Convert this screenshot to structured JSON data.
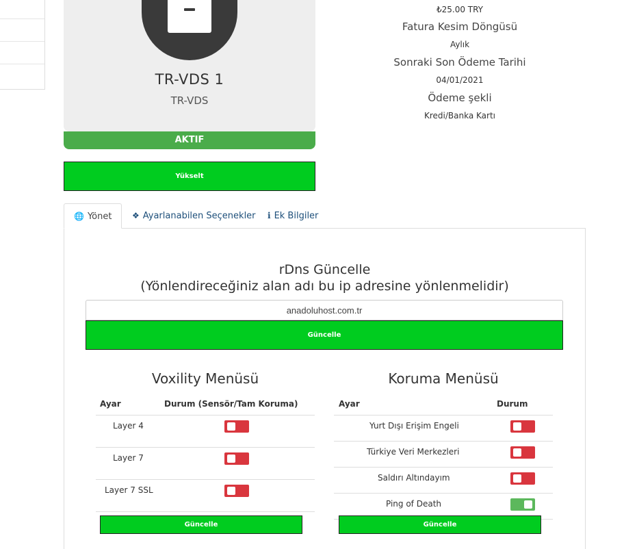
{
  "product": {
    "name": "TR-VDS 1",
    "group": "TR-VDS",
    "status": "AKTIF",
    "upgrade_label": "Yükselt"
  },
  "billing": {
    "amount": "₺25.00 TRY",
    "cycle_label": "Fatura Kesim Döngüsü",
    "cycle_value": "Aylık",
    "due_label": "Sonraki Son Ödeme Tarihi",
    "due_value": "04/01/2021",
    "payment_label": "Ödeme şekli",
    "payment_value": "Kredi/Banka Kartı"
  },
  "tabs": [
    {
      "label": "Yönet",
      "icon": "globe-icon"
    },
    {
      "label": "Ayarlanabilen Seçenekler",
      "icon": "cubes-icon"
    },
    {
      "label": "Ek Bilgiler",
      "icon": "info-icon"
    }
  ],
  "rdns": {
    "title_line1": "rDns Güncelle",
    "title_line2": "(Yönlendireceğiniz alan adı bu ip adresine yönlenmelidir)",
    "input_value": "anadoluhost.com.tr",
    "button_label": "Güncelle"
  },
  "voxility": {
    "title": "Voxility Menüsü",
    "col_setting": "Ayar",
    "col_status": "Durum (Sensör/Tam Koruma)",
    "rows": [
      {
        "label": "Layer 4",
        "on": false
      },
      {
        "label": "Layer 7",
        "on": false
      },
      {
        "label": "Layer 7 SSL",
        "on": false
      }
    ],
    "button_label": "Güncelle"
  },
  "protection": {
    "title": "Koruma Menüsü",
    "col_setting": "Ayar",
    "col_status": "Durum",
    "rows": [
      {
        "label": "Yurt Dışı Erişim Engeli",
        "on": false
      },
      {
        "label": "Türkiye Veri Merkezleri",
        "on": false
      },
      {
        "label": "Saldırı Altındayım",
        "on": false
      },
      {
        "label": "Ping of Death",
        "on": true
      }
    ],
    "button_label": "Güncelle"
  },
  "colors": {
    "primary_green": "#00cc1f",
    "status_green": "#4aac4a",
    "toggle_off": "#d9363e",
    "toggle_on": "#5cb85c"
  }
}
